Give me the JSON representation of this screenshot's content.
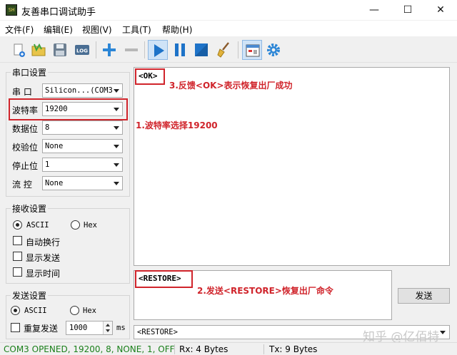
{
  "window": {
    "title": "友善串口调试助手",
    "icon_text": "SH",
    "min_symbol": "—",
    "max_symbol": "☐",
    "close_symbol": "✕"
  },
  "menu": [
    "文件(F)",
    "编辑(E)",
    "视图(V)",
    "工具(T)",
    "帮助(H)"
  ],
  "toolbar": {
    "buttons": [
      "new-icon",
      "open-folder-icon",
      "save-disk-icon",
      "log-icon",
      "add-icon",
      "remove-icon",
      "play-icon",
      "pause-icon",
      "stop-icon",
      "broom-clear-icon",
      "window-layout-icon",
      "gear-icon"
    ],
    "log_label": "LOG"
  },
  "serial_settings": {
    "title": "串口设置",
    "port": {
      "label": "串  口",
      "value": "Silicon...(COM3"
    },
    "baud": {
      "label": "波特率",
      "value": "19200"
    },
    "data_bits": {
      "label": "数据位",
      "value": "8"
    },
    "parity": {
      "label": "校验位",
      "value": "None"
    },
    "stop_bits": {
      "label": "停止位",
      "value": "1"
    },
    "flow": {
      "label": "流  控",
      "value": "None"
    }
  },
  "receive_settings": {
    "title": "接收设置",
    "ascii": "ASCII",
    "hex": "Hex",
    "auto_wrap": "自动换行",
    "show_send": "显示发送",
    "show_time": "显示时间"
  },
  "send_settings": {
    "title": "发送设置",
    "ascii": "ASCII",
    "hex": "Hex",
    "repeat": "重复发送",
    "interval": "1000",
    "unit": "ms"
  },
  "receive_text": "<OK>",
  "send_text": "<RESTORE>",
  "send_button": "发送",
  "history_value": "<RESTORE>",
  "annotations": {
    "baud": "1.波特率选择19200",
    "send": "2.发送<RESTORE>恢复出厂命令",
    "ok": "3.反馈<OK>表示恢复出厂成功"
  },
  "status": {
    "connection": "COM3 OPENED, 19200, 8, NONE, 1, OFF",
    "rx": "Rx: 4 Bytes",
    "tx": "Tx: 9 Bytes"
  },
  "watermark": "知乎 @亿佰特",
  "colors": {
    "annotation_red": "#d0242b",
    "status_green": "#1a7f1a",
    "accent_blue": "#1e73c8"
  }
}
